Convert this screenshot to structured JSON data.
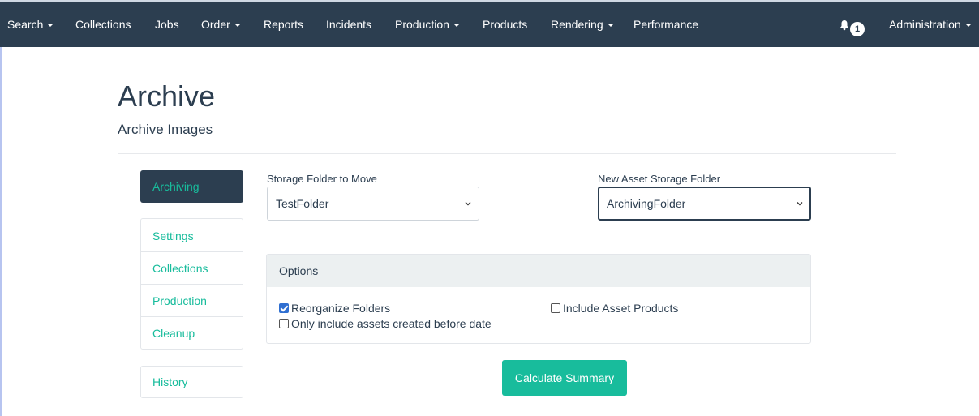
{
  "nav": {
    "items": [
      {
        "label": "Search",
        "dropdown": true
      },
      {
        "label": "Collections",
        "dropdown": false
      },
      {
        "label": "Jobs",
        "dropdown": false
      },
      {
        "label": "Order",
        "dropdown": true
      },
      {
        "label": "Reports",
        "dropdown": false
      },
      {
        "label": "Incidents",
        "dropdown": false
      },
      {
        "label": "Production",
        "dropdown": true
      },
      {
        "label": "Products",
        "dropdown": false
      },
      {
        "label": "Rendering",
        "dropdown": true
      },
      {
        "label": "Performance",
        "dropdown": false
      }
    ],
    "notifications": {
      "icon": "bell-icon",
      "count": "1"
    },
    "admin": {
      "label": "Administration",
      "dropdown": true
    }
  },
  "page": {
    "title": "Archive",
    "subtitle": "Archive Images"
  },
  "sidebar": {
    "active": "Archiving",
    "items": [
      "Settings",
      "Collections",
      "Production",
      "Cleanup"
    ],
    "history": "History"
  },
  "form": {
    "storage_label": "Storage Folder to Move",
    "storage_value": "TestFolder",
    "new_label": "New Asset Storage Folder",
    "new_value": "ArchivingFolder"
  },
  "options": {
    "header": "Options",
    "reorganize": {
      "label": "Reorganize Folders",
      "checked": true
    },
    "include_products": {
      "label": "Include Asset Products",
      "checked": false
    },
    "before_date": {
      "label": "Only include assets created before date",
      "checked": false
    }
  },
  "actions": {
    "calculate": "Calculate Summary"
  },
  "colors": {
    "navbar": "#2c3e50",
    "accent": "#18bc9c",
    "checkbox": "#2f6fd1"
  }
}
